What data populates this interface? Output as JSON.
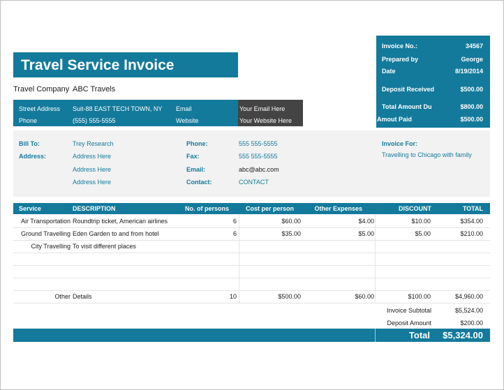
{
  "title": "Travel Service Invoice",
  "company": {
    "label": "Travel Company",
    "name": "ABC Travels"
  },
  "contact": {
    "street_label": "Street Address",
    "street": "Suit-88 EAST TECH TOWN, NY",
    "phone_label": "Phone",
    "phone": "(555) 555-5555",
    "email_label": "Email",
    "email": "Your Email Here",
    "website_label": "Website",
    "website": "Your Website Here"
  },
  "invoice": {
    "no_label": "Invoice No.:",
    "no": "34567",
    "prepared_label": "Prepared by",
    "prepared": "George",
    "date_label": "Date",
    "date": "8/19/2014",
    "deposit_label": "Deposit Received",
    "deposit": "$500.00",
    "total_due_label": "Total Amount Du",
    "total_due": "$800.00",
    "paid_label": "Amout Paid",
    "paid": "$500.00"
  },
  "bill": {
    "to_label": "Bill To:",
    "to": "Trey Research",
    "address_label": "Address:",
    "address_lines": [
      "Address Here",
      "Address Here",
      "Address Here"
    ],
    "phone_label": "Phone:",
    "phone": "555 555-5555",
    "fax_label": "Fax:",
    "fax": "555 555-5555",
    "email_label": "Email:",
    "email": "abc@abc.com",
    "contact_label": "Contact:",
    "contact": "CONTACT",
    "for_label": "Invoice For:",
    "for": "Travelling to Chicago with family"
  },
  "table": {
    "headers": [
      "Service",
      "DESCRIPTION",
      "No. of persons",
      "Cost per person",
      "Other Expenses",
      "DISCOUNT",
      "TOTAL"
    ],
    "rows": [
      [
        "Air Transportation",
        "Roundtrip ticket, American airlines",
        "6",
        "$60.00",
        "$4.00",
        "$10.00",
        "$354.00"
      ],
      [
        "Ground Travelling",
        "Eden Garden to and from hotel",
        "6",
        "$35.00",
        "$5.00",
        "$5.00",
        "$210.00"
      ],
      [
        "City Travelling",
        "To visit different places",
        "",
        "",
        "",
        "",
        ""
      ],
      [
        "",
        "",
        "",
        "",
        "",
        "",
        ""
      ],
      [
        "",
        "",
        "",
        "",
        "",
        "",
        ""
      ],
      [
        "",
        "",
        "",
        "",
        "",
        "",
        ""
      ],
      [
        "Other",
        "Details",
        "10",
        "$500.00",
        "$60.00",
        "$100.00",
        "$4,960.00"
      ]
    ]
  },
  "summary": {
    "subtotal_label": "Invoice Subtotal",
    "subtotal": "$5,524.00",
    "deposit_label": "Deposit Amount",
    "deposit": "$200.00",
    "total_label": "Total",
    "total": "$5,324.00"
  },
  "colors": {
    "accent": "#137a9b",
    "dark": "#444444",
    "shade": "#f2f2f2"
  }
}
